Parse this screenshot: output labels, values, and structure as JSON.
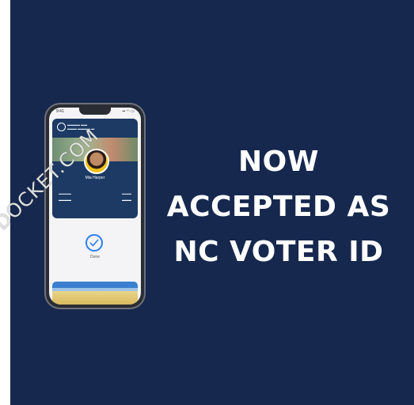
{
  "headline": {
    "line1": "NOW",
    "line2": "ACCEPTED AS",
    "line3": "NC VOTER ID"
  },
  "phone": {
    "status_time": "9:41",
    "status_icons": "▪▪ ◠ ▭",
    "card": {
      "name": "Mia Harper"
    },
    "done_label": "Done"
  },
  "watermark": "DOCKET.COM",
  "colors": {
    "background": "#16284e",
    "text": "#ffffff",
    "accent": "#2e7df0"
  }
}
